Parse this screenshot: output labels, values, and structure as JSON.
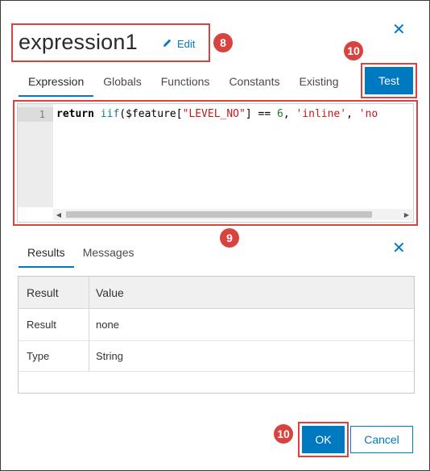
{
  "dialog": {
    "title": "expression1",
    "edit_label": "Edit",
    "close_glyph": "✕"
  },
  "annotations": {
    "title_marker": "8",
    "editor_marker": "9",
    "test_marker": "10",
    "ok_marker": "10"
  },
  "tabs": [
    {
      "label": "Expression"
    },
    {
      "label": "Globals"
    },
    {
      "label": "Functions"
    },
    {
      "label": "Constants"
    },
    {
      "label": "Existing"
    }
  ],
  "test_label": "Test",
  "editor": {
    "line_number": "1",
    "code_line": "return iif($feature[\"LEVEL_NO\"] == 6, 'inline', 'no",
    "tokens": {
      "kw": "return",
      "fn": "iif",
      "p1": "($feature[",
      "s1": "\"LEVEL_NO\"",
      "p2": "] == ",
      "n1": "6",
      "p3": ", ",
      "s2": "'inline'",
      "p4": ", ",
      "s3": "'no"
    }
  },
  "results": {
    "tabs": [
      {
        "label": "Results"
      },
      {
        "label": "Messages"
      }
    ],
    "columns": [
      "Result",
      "Value"
    ],
    "rows": [
      {
        "name": "Result",
        "value": "none"
      },
      {
        "name": "Type",
        "value": "String"
      }
    ]
  },
  "footer": {
    "ok_label": "OK",
    "cancel_label": "Cancel"
  },
  "colors": {
    "accent": "#0079c1",
    "annotation": "#d9433f"
  },
  "icons": {
    "edit": "pencil-icon",
    "close": "close-icon",
    "scroll_left": "scroll-left-icon",
    "scroll_right": "scroll-right-icon"
  }
}
